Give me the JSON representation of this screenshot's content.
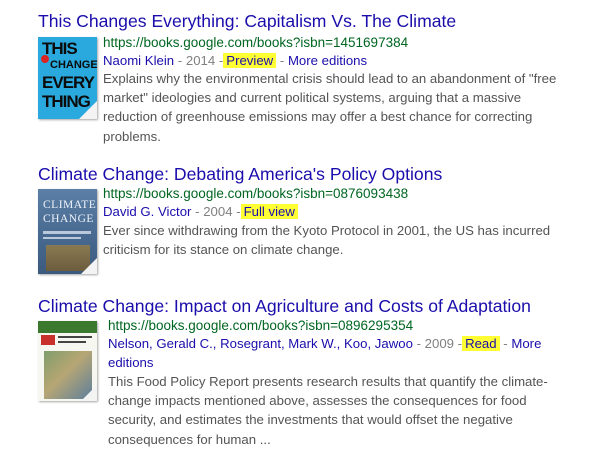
{
  "results": [
    {
      "title": "This Changes Everything: Capitalism Vs. The Climate",
      "url": "https://books.google.com/books?isbn=1451697384",
      "author": "Naomi Klein",
      "year": "2014",
      "dash1": "-",
      "access": "Preview",
      "dash2": "-",
      "more_editions": "More editions",
      "snippet_lines": [
        "Explains why the environmental crisis should lead to an abandonment of \"free",
        "market\" ideologies and current political systems, arguing that a massive",
        "reduction of greenhouse emissions may offer a best chance for correcting",
        "problems."
      ],
      "cover_words": [
        "THIS",
        "CHANGES",
        "EVERY",
        "THING"
      ]
    },
    {
      "title": "Climate Change: Debating America's Policy Options",
      "url": "https://books.google.com/books?isbn=0876093438",
      "author": "David G. Victor",
      "year": "2004",
      "dash1": "-",
      "access": "Full view",
      "snippet_lines": [
        "Ever since withdrawing from the Kyoto Protocol in 2001, the US has incurred",
        "criticism for its stance on climate change."
      ],
      "cover_words": [
        "CLIMATE",
        "CHANGE"
      ]
    },
    {
      "title": "Climate Change: Impact on Agriculture and Costs of Adaptation",
      "url": "https://books.google.com/books?isbn=0896295354",
      "authors_line": "Nelson, Gerald C., Rosegrant, Mark W., Koo, Jawoo",
      "year": "2009",
      "dash1": "-",
      "access": "Read",
      "dash2": "-",
      "more": "More",
      "editions": "editions",
      "snippet_lines": [
        "This Food Policy Report presents research results that quantify the climate-",
        "change impacts mentioned above, assesses the consequences for food",
        "security, and estimates the investments that would offset the negative",
        "consequences for human ..."
      ]
    }
  ]
}
